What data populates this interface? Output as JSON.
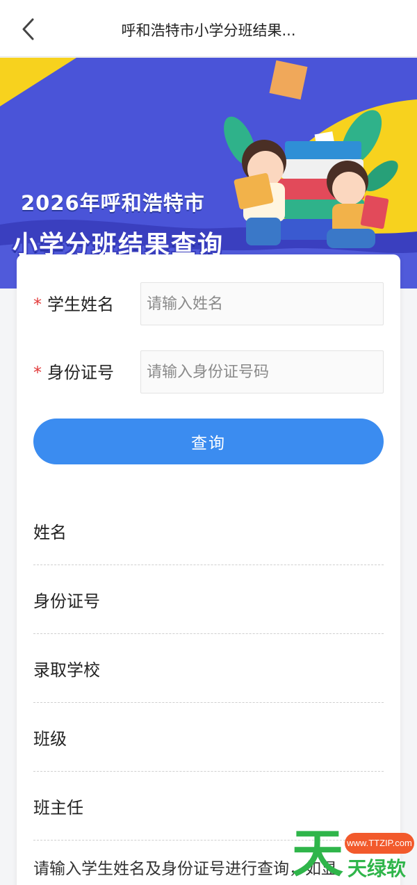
{
  "header": {
    "title": "呼和浩特市小学分班结果..."
  },
  "banner": {
    "line1": "2026年呼和浩特市",
    "line2": "小学分班结果查询"
  },
  "form": {
    "required_mark": "*",
    "name_label": "学生姓名",
    "name_placeholder": "请输入姓名",
    "id_label": "身份证号",
    "id_placeholder": "请输入身份证号码",
    "query_label": "查询"
  },
  "results": {
    "fields": [
      "姓名",
      "身份证号",
      "录取学校",
      "班级",
      "班主任"
    ],
    "hint": "请输入学生姓名及身份证号进行查询，如显"
  },
  "watermark": {
    "big": "天",
    "url": "www.TTZIP.com",
    "cn": "天绿软"
  },
  "colors": {
    "accent": "#3b8cf0",
    "required": "#e23b3b",
    "banner_blue": "#4a54d8",
    "banner_yellow": "#f7d21e"
  }
}
